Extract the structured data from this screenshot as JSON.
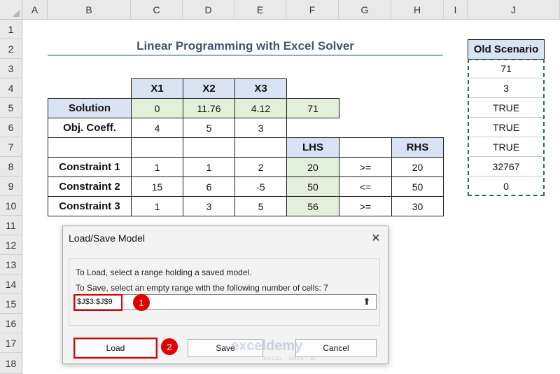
{
  "column_headers": [
    "A",
    "B",
    "C",
    "D",
    "E",
    "F",
    "G",
    "H",
    "I",
    "J"
  ],
  "row_headers": [
    "1",
    "2",
    "3",
    "4",
    "5",
    "6",
    "7",
    "8",
    "9",
    "10",
    "11",
    "12",
    "13",
    "14",
    "15",
    "16",
    "17",
    "18"
  ],
  "sheet": {
    "title": "Linear Programming with Excel Solver",
    "var_headers": [
      "X1",
      "X2",
      "X3"
    ],
    "solution": {
      "label": "Solution",
      "values": [
        "0",
        "11.76",
        "4.12"
      ],
      "objective": "71"
    },
    "obj_coeff": {
      "label": "Obj. Coeff.",
      "values": [
        "4",
        "5",
        "3"
      ]
    },
    "lhs_header": "LHS",
    "rhs_header": "RHS",
    "constraints": [
      {
        "label": "Constraint 1",
        "values": [
          "1",
          "1",
          "2"
        ],
        "lhs": "20",
        "op": ">=",
        "rhs": "20"
      },
      {
        "label": "Constraint 2",
        "values": [
          "15",
          "6",
          "-5"
        ],
        "lhs": "50",
        "op": "<=",
        "rhs": "50"
      },
      {
        "label": "Constraint 3",
        "values": [
          "1",
          "3",
          "5"
        ],
        "lhs": "56",
        "op": ">=",
        "rhs": "30"
      }
    ],
    "old_scenario": {
      "header": "Old Scenario",
      "values": [
        "71",
        "3",
        "TRUE",
        "TRUE",
        "TRUE",
        "32767",
        "0"
      ]
    }
  },
  "dialog": {
    "title": "Load/Save Model",
    "close_glyph": "✕",
    "line1": "To Load, select a range holding a saved model.",
    "line2": "To Save, select an empty range with the following number of cells: 7",
    "range_value": "$J$3:$J$9",
    "upload_glyph": "⬆",
    "badge1": "1",
    "badge2": "2",
    "load_label": "Load",
    "save_label": "Save",
    "cancel_label": "Cancel",
    "accent_red": "#e00000"
  },
  "watermark": {
    "name": "exceldemy",
    "tagline": "EXCEL · DATA · BI"
  }
}
